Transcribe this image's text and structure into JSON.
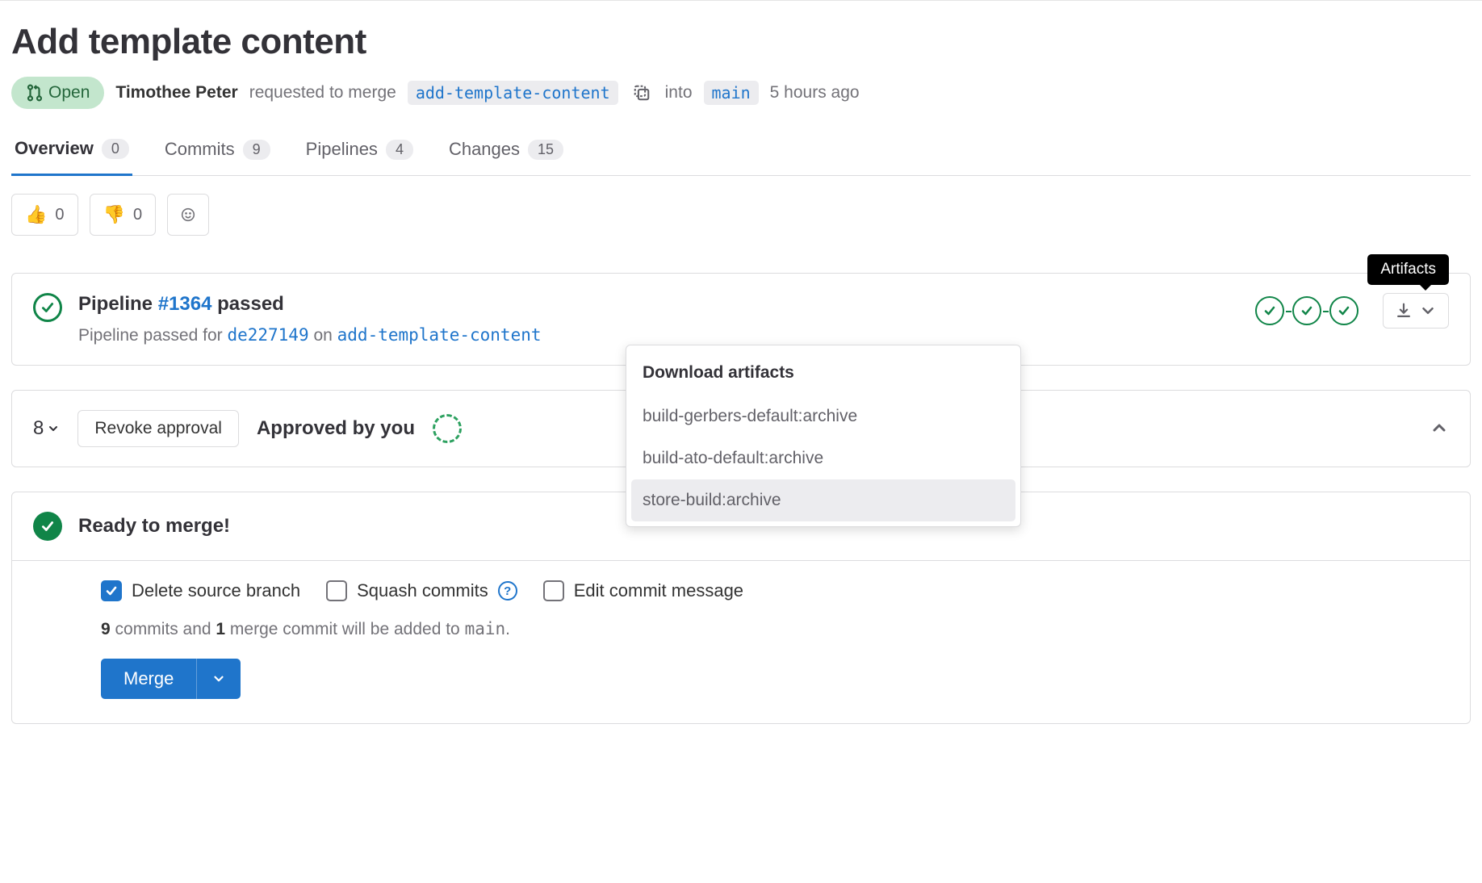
{
  "title": "Add template content",
  "status": {
    "label": "Open"
  },
  "author": "Timothee Peter",
  "requested_text": "requested to merge",
  "source_branch": "add-template-content",
  "into_text": "into",
  "target_branch": "main",
  "time_ago": "5 hours ago",
  "tabs": [
    {
      "label": "Overview",
      "count": "0",
      "active": true
    },
    {
      "label": "Commits",
      "count": "9",
      "active": false
    },
    {
      "label": "Pipelines",
      "count": "4",
      "active": false
    },
    {
      "label": "Changes",
      "count": "15",
      "active": false
    }
  ],
  "reactions": {
    "thumbsup": {
      "emoji": "👍",
      "count": "0"
    },
    "thumbsdown": {
      "emoji": "👎",
      "count": "0"
    }
  },
  "pipeline": {
    "prefix": "Pipeline ",
    "id": "#1364",
    "suffix": " passed",
    "sub_prefix": "Pipeline passed for ",
    "sha": "de227149",
    "sub_mid": " on ",
    "branch": "add-template-content",
    "stages": 3,
    "artifacts_tooltip": "Artifacts"
  },
  "artifacts_menu": {
    "header": "Download artifacts",
    "items": [
      "build-gerbers-default:archive",
      "build-ato-default:archive",
      "store-build:archive"
    ],
    "hovered": 2
  },
  "approval": {
    "count": "8",
    "revoke_label": "Revoke approval",
    "approved_label": "Approved by you"
  },
  "merge": {
    "ready_label": "Ready to merge!",
    "delete_branch_label": "Delete source branch",
    "squash_label": "Squash commits",
    "edit_commit_label": "Edit commit message",
    "delete_checked": true,
    "squash_checked": false,
    "edit_checked": false,
    "note_commits": "9",
    "note_mid1": " commits and ",
    "note_merges": "1",
    "note_mid2": " merge commit will be added to ",
    "note_branch": "main",
    "note_end": ".",
    "button_label": "Merge"
  }
}
